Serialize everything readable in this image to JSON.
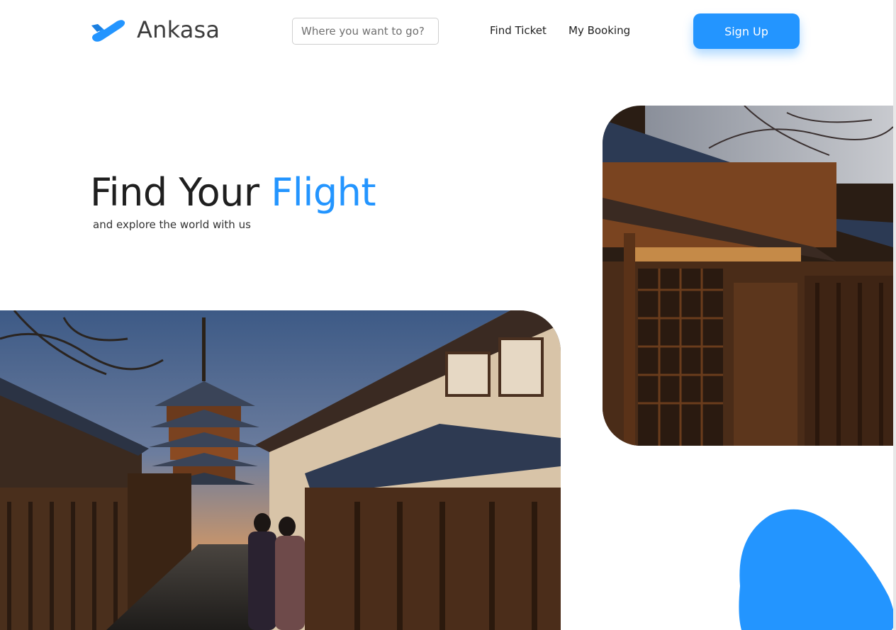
{
  "brand": {
    "name": "Ankasa",
    "logo_icon": "plane-icon"
  },
  "search": {
    "placeholder": "Where you want to go?",
    "value": ""
  },
  "nav": {
    "find_ticket": "Find Ticket",
    "my_booking": "My Booking"
  },
  "signup": {
    "label": "Sign Up"
  },
  "hero": {
    "title_part1": "Find Your ",
    "title_accent": "Flight",
    "subtitle": "and explore the world with us"
  },
  "colors": {
    "accent": "#2395ff",
    "text": "#1f1f1f"
  }
}
